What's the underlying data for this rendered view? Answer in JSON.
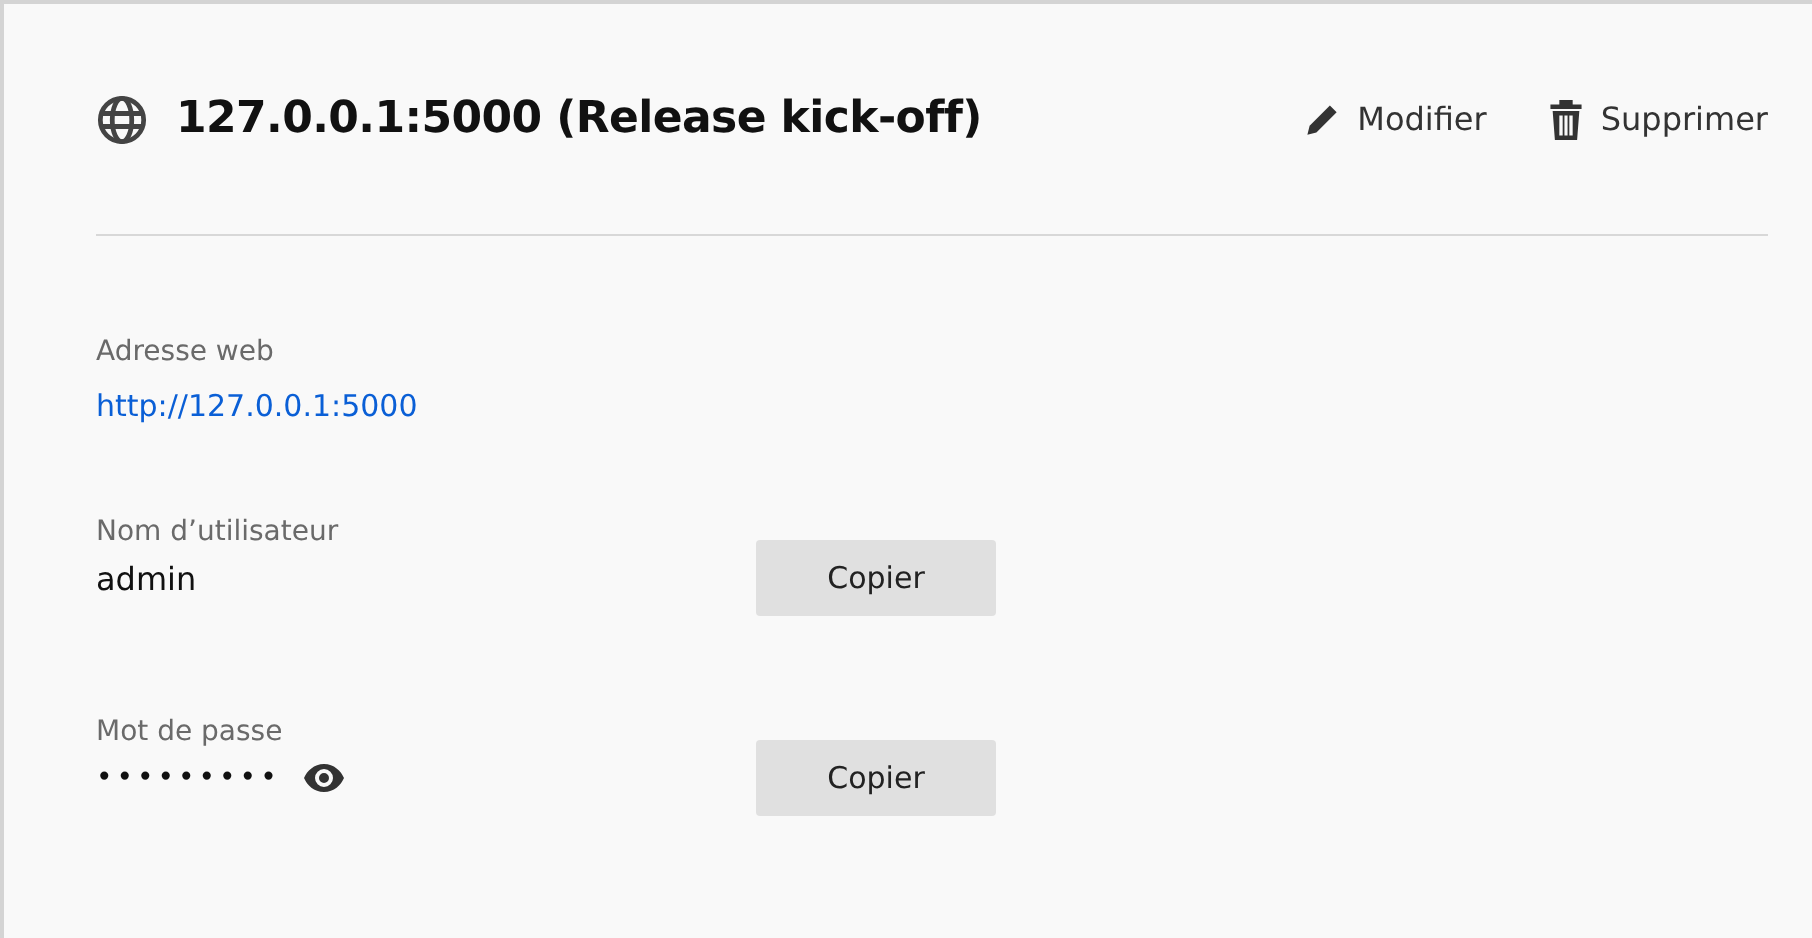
{
  "header": {
    "title": "127.0.0.1:5000 (Release kick-off)",
    "actions": [
      {
        "kind": "edit",
        "label": "Modifier"
      },
      {
        "kind": "delete",
        "label": "Supprimer"
      }
    ]
  },
  "fields": [
    {
      "kind": "link",
      "label": "Adresse web",
      "value": "http://127.0.0.1:5000"
    },
    {
      "kind": "copy",
      "label": "Nom d’utilisateur",
      "value": "admin",
      "button": "Copier"
    },
    {
      "kind": "secret",
      "label": "Mot de passe",
      "value": "•••••••••",
      "button": "Copier"
    }
  ]
}
